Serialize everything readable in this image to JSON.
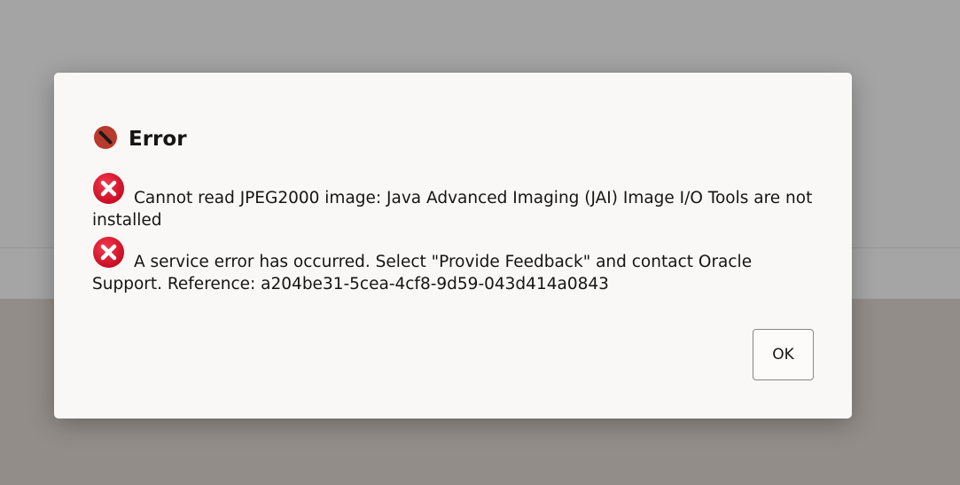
{
  "dialog": {
    "title": "Error",
    "header_icon": "prohibited-icon",
    "messages": [
      {
        "icon": "error-x-icon",
        "text": "Cannot read JPEG2000 image: Java Advanced Imaging (JAI) Image I/O Tools are not installed"
      },
      {
        "icon": "error-x-icon",
        "text": "A service error has occurred. Select \"Provide Feedback\" and contact Oracle Support. Reference: a204be31-5cea-4cf8-9d59-043d414a0843"
      }
    ],
    "ok_label": "OK"
  },
  "colors": {
    "overlay": "#a3a3a3",
    "dialog_bg": "#f9f8f6",
    "error_red": "#d5102a",
    "header_icon_red": "#b83a2c",
    "text": "#161513"
  }
}
